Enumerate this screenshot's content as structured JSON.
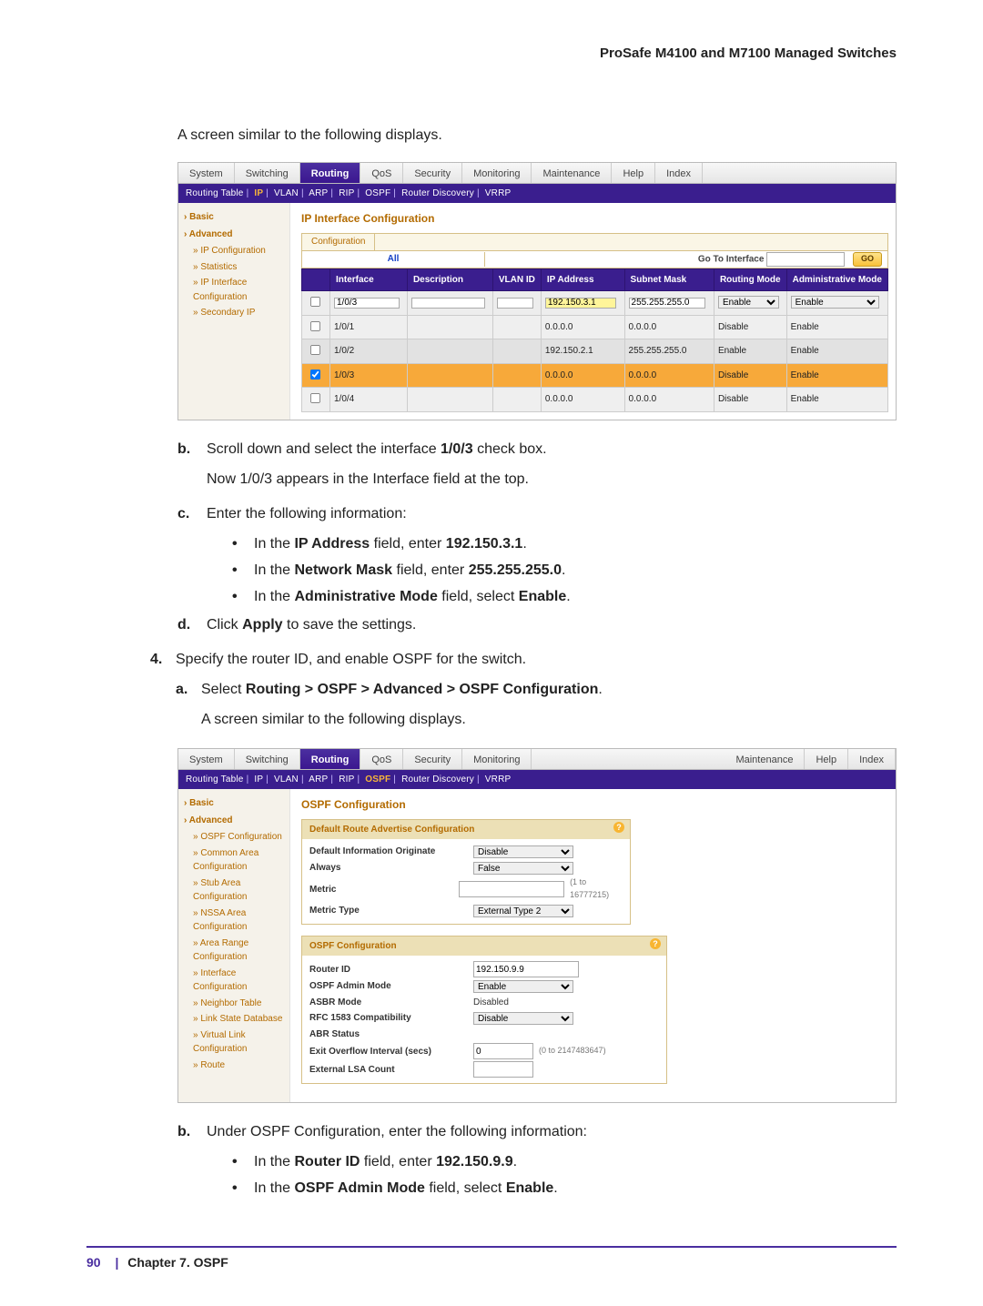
{
  "header": {
    "title": "ProSafe M4100 and M7100 Managed Switches"
  },
  "intro": "A screen similar to the following displays.",
  "shot1": {
    "tabs": [
      "System",
      "Switching",
      "Routing",
      "QoS",
      "Security",
      "Monitoring",
      "Maintenance",
      "Help",
      "Index"
    ],
    "active_tab": "Routing",
    "subtabs": [
      "Routing Table",
      "IP",
      "VLAN",
      "ARP",
      "RIP",
      "OSPF",
      "Router Discovery",
      "VRRP"
    ],
    "title": "IP Interface Configuration",
    "sidebar": {
      "basic": "Basic",
      "advanced": "Advanced",
      "items": [
        "IP Configuration",
        "Statistics",
        "IP Interface Configuration",
        "Secondary IP"
      ]
    },
    "cfg_label": "Configuration",
    "all": "All",
    "goto_label": "Go To Interface",
    "go": "GO",
    "cols": [
      "",
      "Interface",
      "Description",
      "VLAN ID",
      "IP Address",
      "Subnet Mask",
      "Routing Mode",
      "Administrative Mode"
    ],
    "input": {
      "iface": "1/0/3",
      "desc": "",
      "vlan": "",
      "ip": "192.150.3.1",
      "mask": "255.255.255.0",
      "rmode": "Enable",
      "amode": "Enable"
    },
    "rows": [
      {
        "chk": false,
        "iface": "1/0/1",
        "ip": "0.0.0.0",
        "mask": "0.0.0.0",
        "rmode": "Disable",
        "amode": "Enable",
        "cls": "r-gray"
      },
      {
        "chk": false,
        "iface": "1/0/2",
        "ip": "192.150.2.1",
        "mask": "255.255.255.0",
        "rmode": "Enable",
        "amode": "Enable",
        "cls": "r-dark"
      },
      {
        "chk": true,
        "iface": "1/0/3",
        "ip": "0.0.0.0",
        "mask": "0.0.0.0",
        "rmode": "Disable",
        "amode": "Enable",
        "cls": "r-orange"
      },
      {
        "chk": false,
        "iface": "1/0/4",
        "ip": "0.0.0.0",
        "mask": "0.0.0.0",
        "rmode": "Disable",
        "amode": "Enable",
        "cls": "r-gray"
      }
    ]
  },
  "steps": {
    "b": {
      "pre": "Scroll down and select the interface ",
      "bold": "1/0/3",
      "post": " check box."
    },
    "b_note": "Now 1/0/3 appears in the Interface field at the top.",
    "c": "Enter the following information:",
    "c1": {
      "pre": "In the ",
      "b1": "IP Address",
      "mid": " field, enter ",
      "b2": "192.150.3.1",
      "post": "."
    },
    "c2": {
      "pre": "In the ",
      "b1": "Network Mask",
      "mid": " field, enter ",
      "b2": "255.255.255.0",
      "post": "."
    },
    "c3": {
      "pre": "In the ",
      "b1": "Administrative Mode",
      "mid": " field, select ",
      "b2": "Enable",
      "post": "."
    },
    "d": {
      "pre": "Click ",
      "b": "Apply",
      "post": " to save the settings."
    },
    "s4": "Specify the router ID, and enable OSPF for the switch.",
    "s4a": {
      "pre": "Select ",
      "b": "Routing > OSPF > Advanced > OSPF Configuration",
      "post": "."
    },
    "s4a_note": "A screen similar to the following displays.",
    "s4b": "Under OSPF Configuration, enter the following information:",
    "s4b1": {
      "pre": "In the ",
      "b1": "Router ID",
      "mid": " field, enter ",
      "b2": "192.150.9.9",
      "post": "."
    },
    "s4b2": {
      "pre": "In the ",
      "b1": "OSPF Admin Mode",
      "mid": " field, select ",
      "b2": "Enable",
      "post": "."
    }
  },
  "shot2": {
    "tabs": [
      "System",
      "Switching",
      "Routing",
      "QoS",
      "Security",
      "Monitoring",
      "Maintenance",
      "Help",
      "Index"
    ],
    "active_tab": "Routing",
    "subtabs": [
      "Routing Table",
      "IP",
      "VLAN",
      "ARP",
      "RIP",
      "OSPF",
      "Router Discovery",
      "VRRP"
    ],
    "sidebar": {
      "basic": "Basic",
      "advanced": "Advanced",
      "items": [
        "OSPF Configuration",
        "Common Area Configuration",
        "Stub Area Configuration",
        "NSSA Area Configuration",
        "Area Range Configuration",
        "Interface Configuration",
        "Neighbor Table",
        "Link State Database",
        "Virtual Link Configuration",
        "Route"
      ]
    },
    "title": "OSPF Configuration",
    "panel1": {
      "hd": "Default Route Advertise Configuration",
      "rows": [
        {
          "lbl": "Default Information Originate",
          "type": "select",
          "val": "Disable"
        },
        {
          "lbl": "Always",
          "type": "select",
          "val": "False"
        },
        {
          "lbl": "Metric",
          "type": "input",
          "val": "",
          "hint": "(1 to 16777215)"
        },
        {
          "lbl": "Metric Type",
          "type": "select",
          "val": "External Type 2"
        }
      ]
    },
    "panel2": {
      "hd": "OSPF Configuration",
      "rows": [
        {
          "lbl": "Router ID",
          "type": "input",
          "val": "192.150.9.9"
        },
        {
          "lbl": "OSPF Admin Mode",
          "type": "select",
          "val": "Enable"
        },
        {
          "lbl": "ASBR Mode",
          "type": "static",
          "val": "Disabled"
        },
        {
          "lbl": "RFC 1583 Compatibility",
          "type": "select",
          "val": "Disable"
        },
        {
          "lbl": "ABR Status",
          "type": "static",
          "val": ""
        },
        {
          "lbl": "Exit Overflow Interval (secs)",
          "type": "input",
          "val": "0",
          "hint": "(0 to 2147483647)"
        },
        {
          "lbl": "External LSA Count",
          "type": "static",
          "val": ""
        }
      ]
    }
  },
  "footer": {
    "page": "90",
    "chapter": "Chapter 7.  OSPF"
  }
}
